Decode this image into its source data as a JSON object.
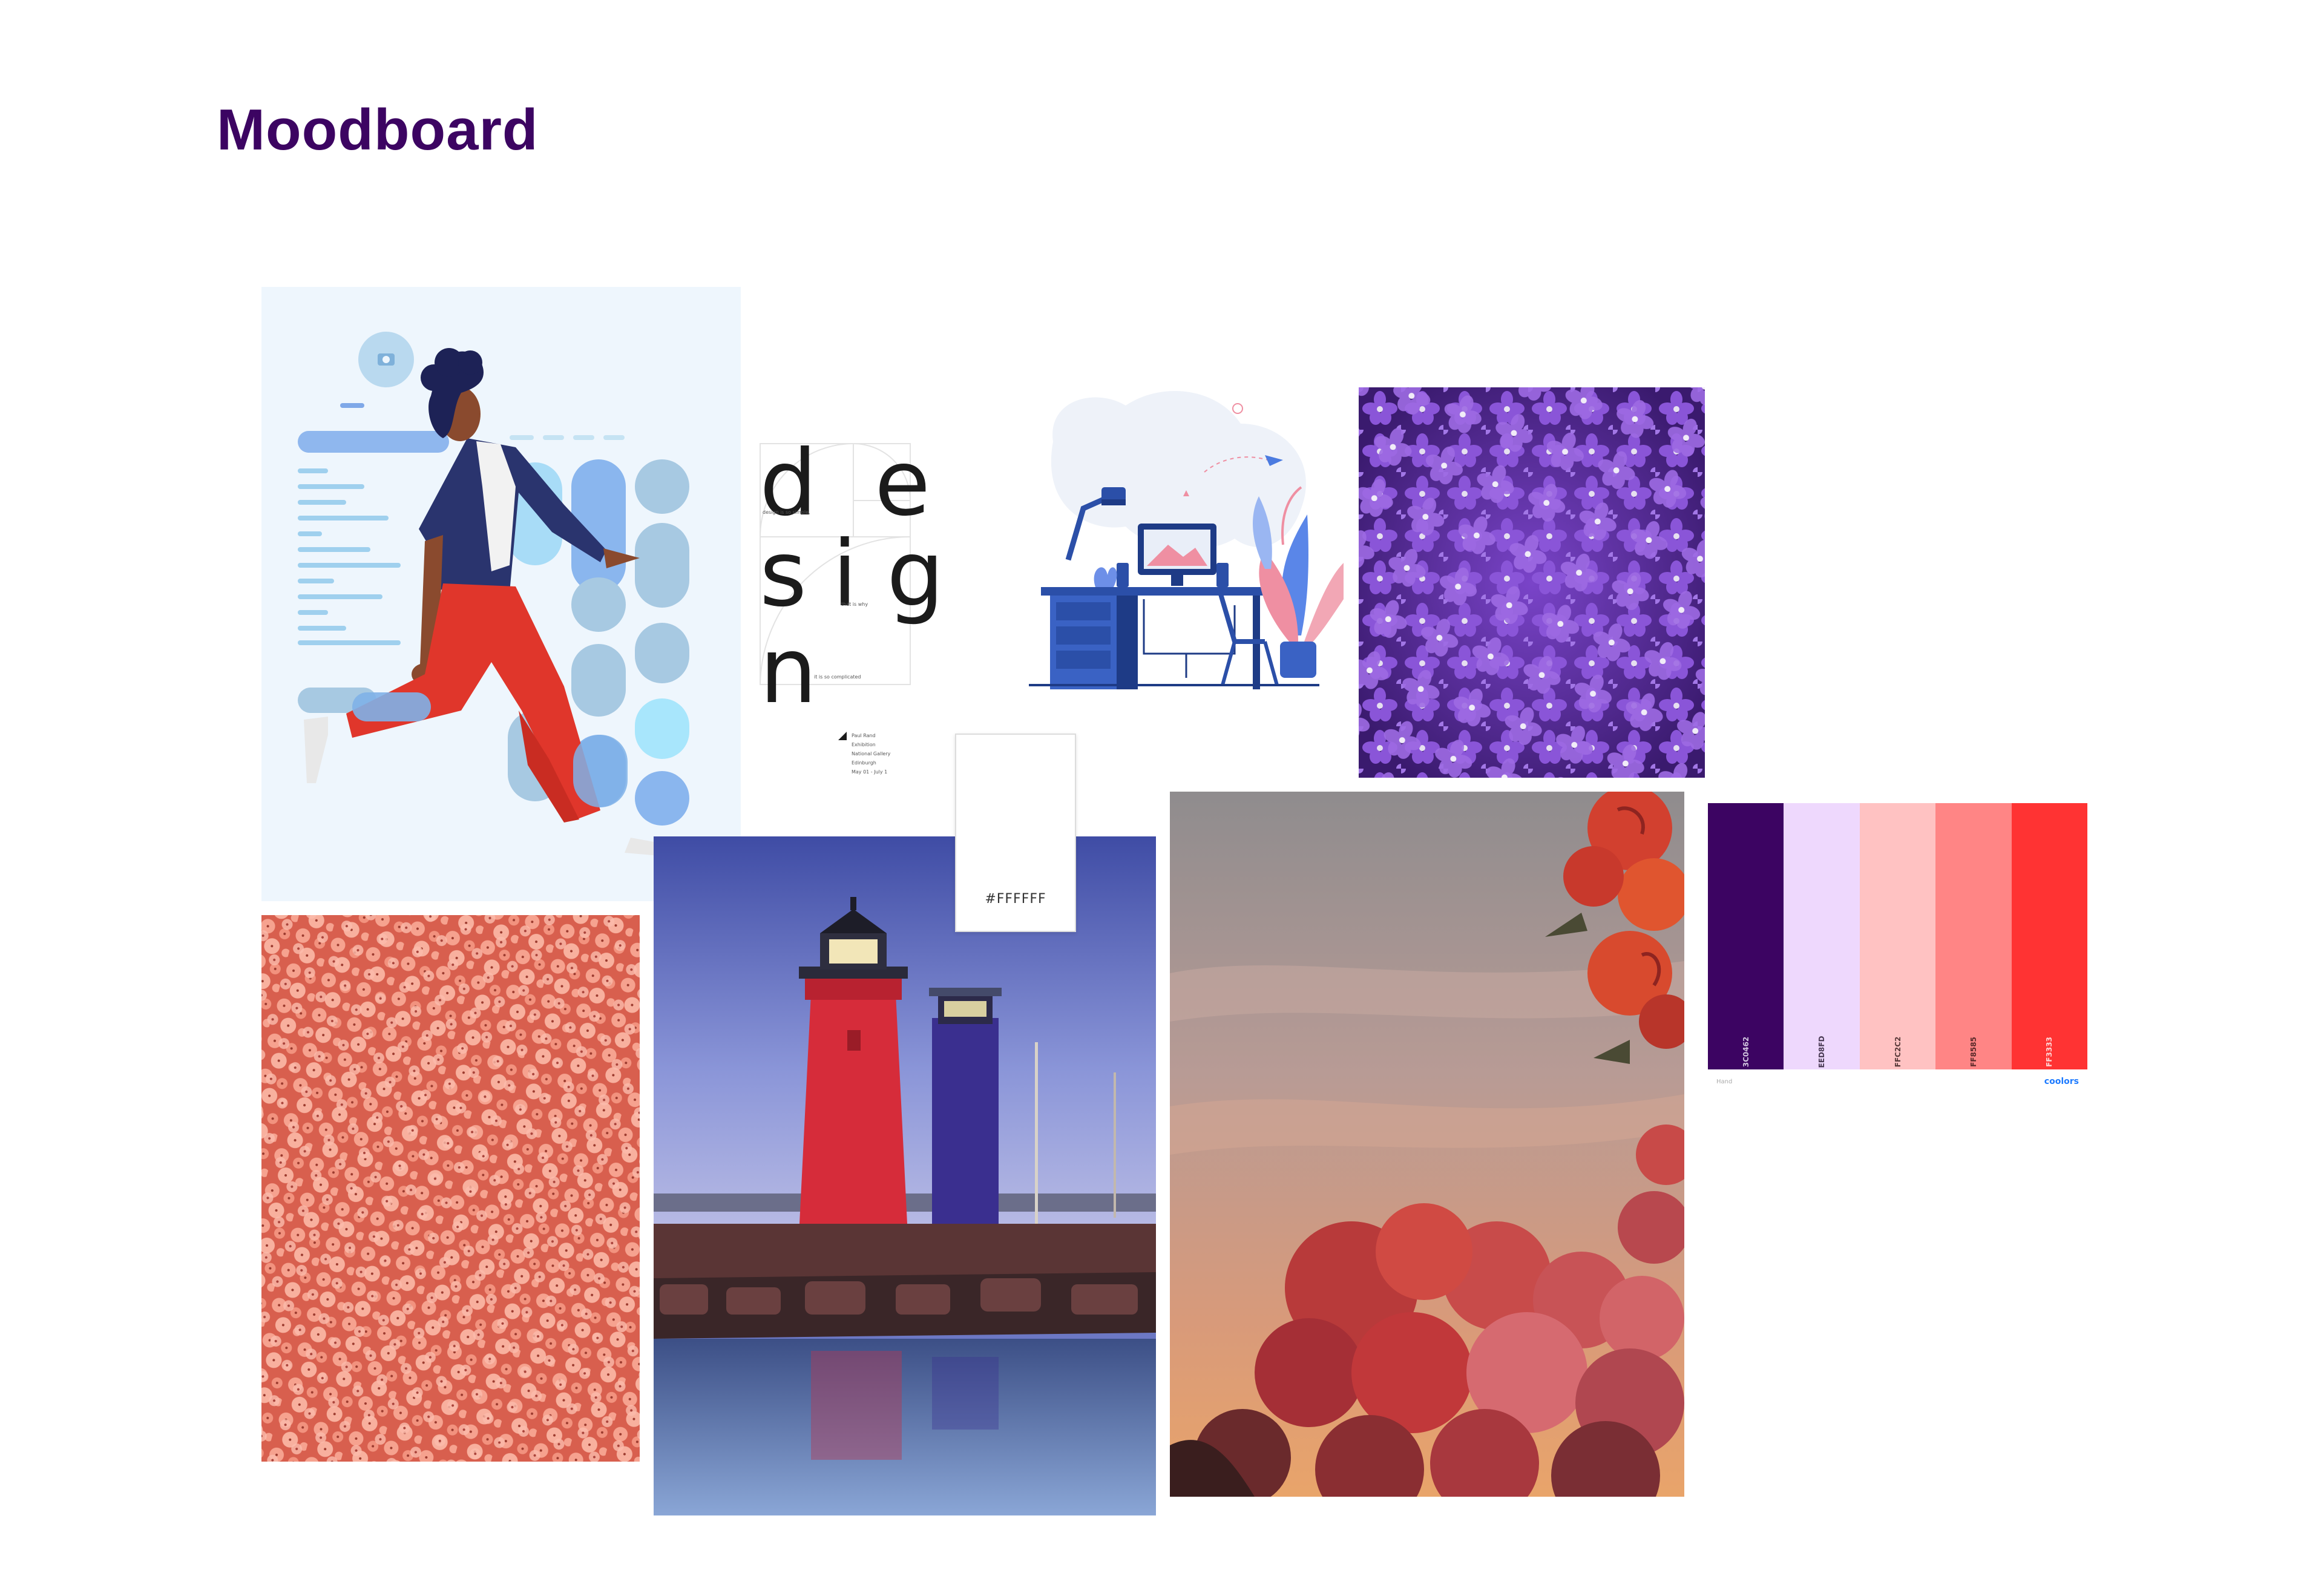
{
  "title": "Moodboard",
  "design_poster": {
    "letters": [
      "d",
      "e",
      "s",
      "i",
      "g",
      "n"
    ],
    "line1": "design is so simple,",
    "line2": "that is why",
    "line3": "it is so complicated",
    "info": [
      "Paul Rand",
      "Exhibition",
      "National Gallery",
      "Edinburgh",
      "May 01 - July 1"
    ]
  },
  "white_swatch": {
    "hex": "#FFFFFF"
  },
  "palette": {
    "swatches": [
      {
        "hex": "#3C0462",
        "label": "3C0462",
        "text_color": "#cfc2dd"
      },
      {
        "hex": "#EED8FD",
        "label": "EED8FD",
        "text_color": "#4a3a55"
      },
      {
        "hex": "#FFC2C2",
        "label": "FFC2C2",
        "text_color": "#5a3a3a"
      },
      {
        "hex": "#FF8585",
        "label": "FF8585",
        "text_color": "#5a2a2a"
      },
      {
        "hex": "#FF3333",
        "label": "FF3333",
        "text_color": "#ffd6d6"
      }
    ],
    "footer_left": "Hand",
    "brand": "coolors"
  },
  "icons": {
    "camera": "camera-icon",
    "arrow": "triangle-icon"
  }
}
